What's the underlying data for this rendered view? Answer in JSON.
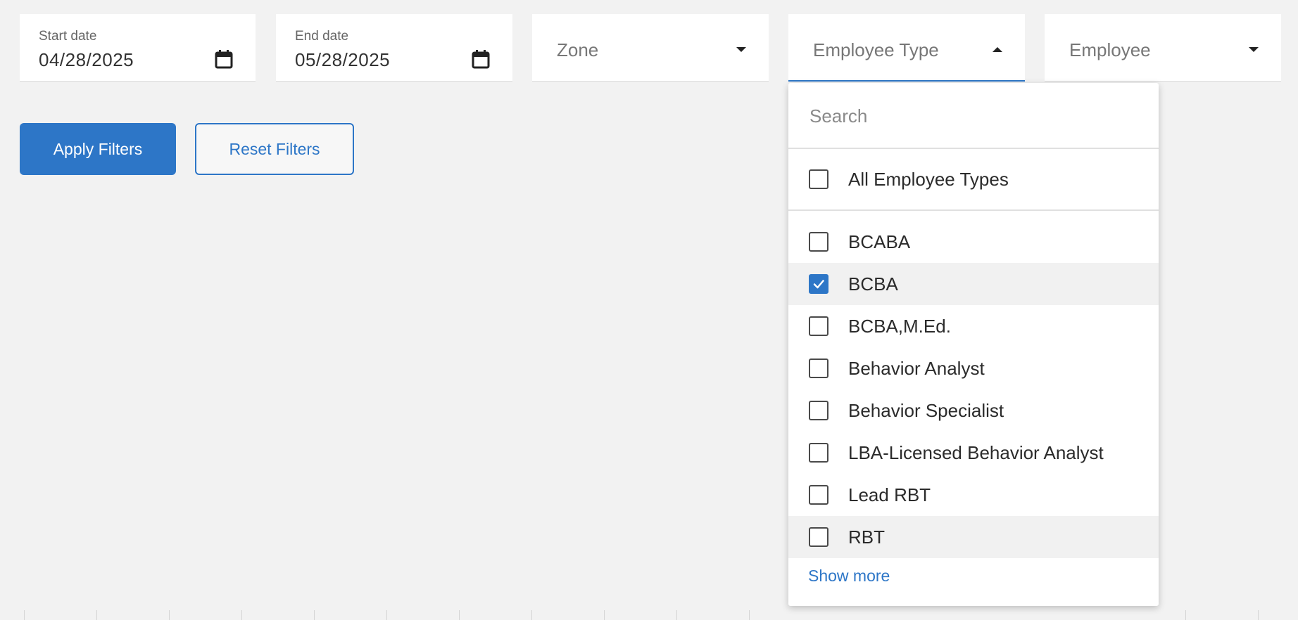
{
  "filters": {
    "start_date": {
      "label": "Start date",
      "value": "04/28/2025",
      "icon": "calendar-icon"
    },
    "end_date": {
      "label": "End date",
      "value": "05/28/2025",
      "icon": "calendar-icon"
    },
    "zone": {
      "placeholder": "Zone",
      "icon": "caret-down-icon"
    },
    "employee_type": {
      "placeholder": "Employee Type",
      "icon": "caret-up-icon",
      "open": true
    },
    "employee": {
      "placeholder": "Employee",
      "icon": "caret-down-icon"
    }
  },
  "buttons": {
    "apply": "Apply Filters",
    "reset": "Reset Filters"
  },
  "dropdown": {
    "search_placeholder": "Search",
    "all_label": "All Employee Types",
    "all_checked": false,
    "options": [
      {
        "label": "BCABA",
        "checked": false
      },
      {
        "label": "BCBA",
        "checked": true
      },
      {
        "label": "BCBA,M.Ed.",
        "checked": false
      },
      {
        "label": "Behavior Analyst",
        "checked": false
      },
      {
        "label": "Behavior Specialist",
        "checked": false
      },
      {
        "label": "LBA-Licensed Behavior Analyst",
        "checked": false
      },
      {
        "label": "Lead RBT",
        "checked": false
      },
      {
        "label": "RBT",
        "checked": false
      }
    ],
    "show_more": "Show more"
  },
  "colors": {
    "accent": "#2d76c7",
    "background": "#f2f2f2",
    "surface": "#ffffff"
  }
}
